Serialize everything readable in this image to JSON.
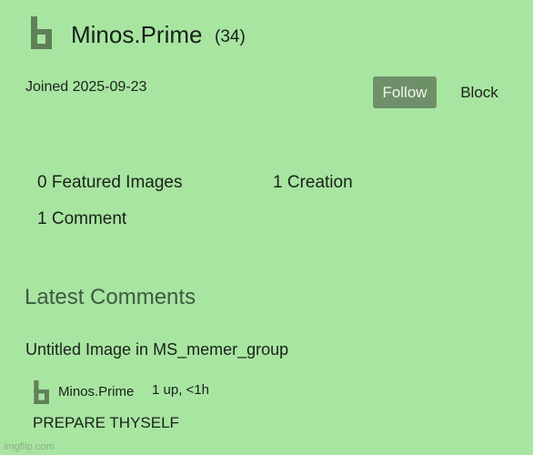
{
  "profile": {
    "username": "Minos.Prime",
    "points": "(34)",
    "joined": "Joined 2025-09-23",
    "avatar_icon": "user-avatar-icon",
    "follow_label": "Follow",
    "block_label": "Block"
  },
  "stats": {
    "featured_images": "0 Featured Images",
    "creations": "1 Creation",
    "comments": "1 Comment"
  },
  "latest_comments": {
    "title": "Latest Comments",
    "items": [
      {
        "image_title": "Untitled Image in MS_memer_group",
        "author": "Minos.Prime",
        "meta": "1 up, <1h",
        "text": "PREPARE THYSELF"
      }
    ]
  },
  "watermark": "imgflip.com",
  "colors": {
    "background": "#a8e5a1",
    "avatar": "#5f8059",
    "follow_button": "#6e9068",
    "section_title": "#3f5a42"
  }
}
